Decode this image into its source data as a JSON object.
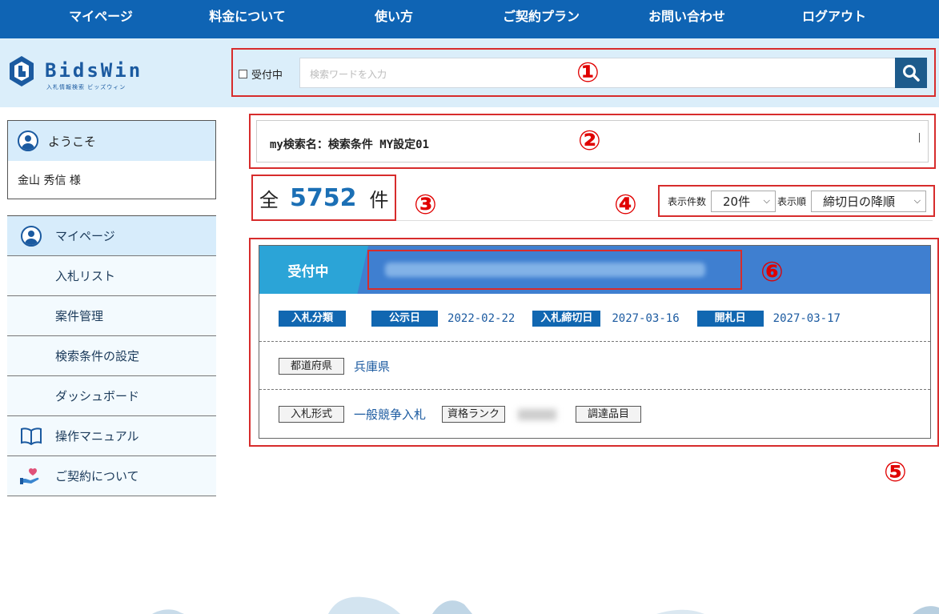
{
  "topnav": {
    "items": [
      "マイページ",
      "料金について",
      "使い方",
      "ご契約プラン",
      "お問い合わせ",
      "ログアウト"
    ]
  },
  "logo": {
    "text": "BidsWin",
    "sub": "入札情報検索 ビッズウィン"
  },
  "search": {
    "checkbox_label": "受付中",
    "placeholder": "検索ワードを入力",
    "button_icon": "search-icon"
  },
  "markers": [
    "①",
    "②",
    "③",
    "④",
    "⑤",
    "⑥"
  ],
  "welcome": {
    "title": "ようこそ",
    "user": "金山 秀信 様"
  },
  "sidebar": {
    "items": [
      {
        "label": "マイページ",
        "icon": "user-icon"
      },
      {
        "label": "入札リスト"
      },
      {
        "label": "案件管理"
      },
      {
        "label": "検索条件の設定"
      },
      {
        "label": "ダッシュボード"
      },
      {
        "label": "操作マニュアル",
        "icon": "book-icon"
      },
      {
        "label": "ご契約について",
        "icon": "hand-heart-icon"
      }
    ]
  },
  "mysearch": {
    "label": "my検索名：検索条件 MY設定01"
  },
  "count": {
    "prefix": "全",
    "value": "5752",
    "suffix": "件"
  },
  "options": {
    "per_page_label": "表示件数",
    "per_page_value": "20件",
    "order_label": "表示順",
    "order_value": "締切日の降順"
  },
  "result": {
    "status": "受付中",
    "row1": {
      "category_label": "入札分類",
      "public_label": "公示日",
      "public_date": "2022-02-22",
      "deadline_label": "入札締切日",
      "deadline_date": "2027-03-16",
      "opening_label": "開札日",
      "opening_date": "2027-03-17"
    },
    "row2": {
      "pref_label": "都道府県",
      "pref_value": "兵庫県"
    },
    "row3": {
      "type_label": "入札形式",
      "type_value": "一般競争入札",
      "rank_label": "資格ランク",
      "item_label": "調達品目"
    }
  },
  "colors": {
    "nav": "#0f64b4",
    "accent": "#1167b1",
    "highlight": "#d72c2c",
    "status": "#2ba4d7"
  }
}
